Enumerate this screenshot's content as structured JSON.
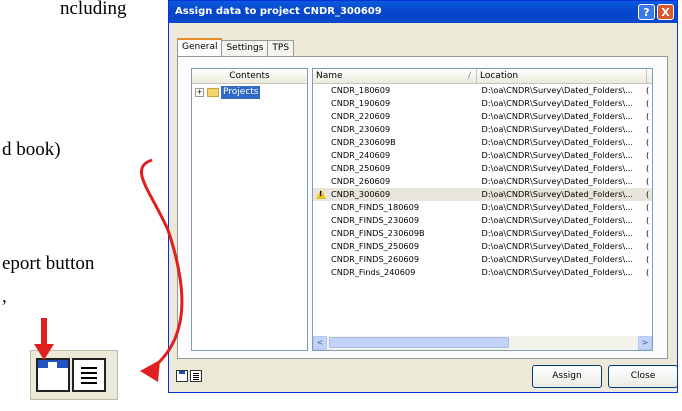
{
  "background_text": [
    {
      "text": "ncluding"
    },
    {
      "text": "d book)"
    },
    {
      "text": "eport button"
    },
    {
      "text": ","
    }
  ],
  "dialog": {
    "title": "Assign data to project CNDR_300609",
    "help_glyph": "?",
    "close_glyph": "X",
    "tabs": [
      {
        "label": "General",
        "active": true
      },
      {
        "label": "Settings",
        "active": false
      },
      {
        "label": "TPS",
        "active": false
      }
    ],
    "tree": {
      "header": "Contents",
      "expander": "+",
      "root_label": "Projects"
    },
    "list": {
      "columns": {
        "name": "Name",
        "location": "Location",
        "sort_mark": "/"
      },
      "rows": [
        {
          "name": "CNDR_180609",
          "location": "D:\\oa\\CNDR\\Survey\\Dated_Folders\\...",
          "extra": "("
        },
        {
          "name": "CNDR_190609",
          "location": "D:\\oa\\CNDR\\Survey\\Dated_Folders\\...",
          "extra": "("
        },
        {
          "name": "CNDR_220609",
          "location": "D:\\oa\\CNDR\\Survey\\Dated_Folders\\...",
          "extra": "("
        },
        {
          "name": "CNDR_230609",
          "location": "D:\\oa\\CNDR\\Survey\\Dated_Folders\\...",
          "extra": "("
        },
        {
          "name": "CNDR_230609B",
          "location": "D:\\oa\\CNDR\\Survey\\Dated_Folders\\...",
          "extra": "("
        },
        {
          "name": "CNDR_240609",
          "location": "D:\\oa\\CNDR\\Survey\\Dated_Folders\\...",
          "extra": "("
        },
        {
          "name": "CNDR_250609",
          "location": "D:\\oa\\CNDR\\Survey\\Dated_Folders\\...",
          "extra": "("
        },
        {
          "name": "CNDR_260609",
          "location": "D:\\oa\\CNDR\\Survey\\Dated_Folders\\...",
          "extra": "("
        },
        {
          "name": "CNDR_300609",
          "location": "D:\\oa\\CNDR\\Survey\\Dated_Folders\\...",
          "extra": "(",
          "warning": true,
          "selected": true
        },
        {
          "name": "CNDR_FINDS_180609",
          "location": "D:\\oa\\CNDR\\Survey\\Dated_Folders\\...",
          "extra": "("
        },
        {
          "name": "CNDR_FINDS_230609",
          "location": "D:\\oa\\CNDR\\Survey\\Dated_Folders\\...",
          "extra": "("
        },
        {
          "name": "CNDR_FINDS_230609B",
          "location": "D:\\oa\\CNDR\\Survey\\Dated_Folders\\...",
          "extra": "("
        },
        {
          "name": "CNDR_FINDS_250609",
          "location": "D:\\oa\\CNDR\\Survey\\Dated_Folders\\...",
          "extra": "("
        },
        {
          "name": "CNDR_FINDS_260609",
          "location": "D:\\oa\\CNDR\\Survey\\Dated_Folders\\...",
          "extra": "("
        },
        {
          "name": "CNDR_Finds_240609",
          "location": "D:\\oa\\CNDR\\Survey\\Dated_Folders\\...",
          "extra": "("
        }
      ],
      "scroll_left": "<",
      "scroll_right": ">"
    },
    "buttons": {
      "assign": "Assign",
      "close": "Close"
    }
  },
  "colors": {
    "annotation_red": "#e02020",
    "titlebar_blue": "#0545c9",
    "selection_blue": "#316ac5"
  },
  "icons": [
    "save-icon",
    "report-icon",
    "folder-icon",
    "warning-icon"
  ]
}
